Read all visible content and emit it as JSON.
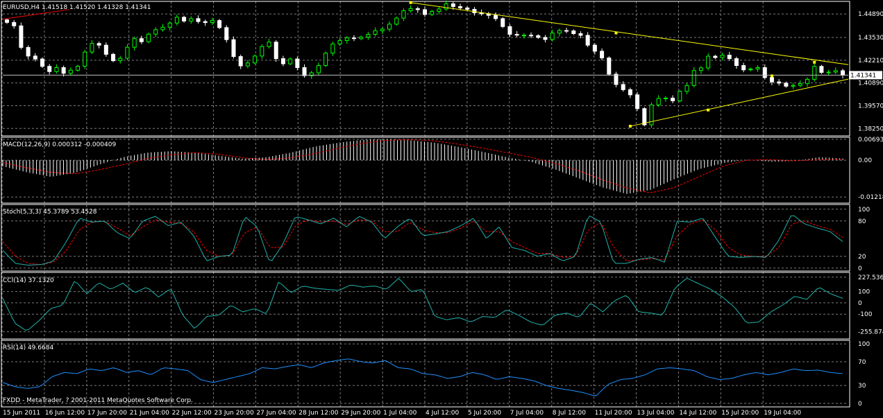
{
  "colors": {
    "background": "#000000",
    "grid": "#7c7c7c",
    "text": "#ffffff",
    "bull_candle": "#000000",
    "bull_border": "#00ff00",
    "bear_candle": "#ffffff",
    "trendline": "#ffff00",
    "red_line": "#ff0000",
    "macd_hist": "#ffffff",
    "signal": "#ff0000",
    "stoch_main": "#20b2aa",
    "cci": "#20b2aa",
    "rsi": "#1e90ff"
  },
  "header": {
    "price_title": "EURUSD,H4  1.41518 1.41520 1.41328 1.41341",
    "current_price": "1.41341",
    "copyright": "FXDD - MetaTrader, ? 2001-2011 MetaQuotes Software Corp."
  },
  "chart_data": [
    {
      "type": "candlestick",
      "title": "EURUSD,H4  1.41518 1.41520 1.41328 1.41341",
      "ylim": [
        1.3782,
        1.4562
      ],
      "y_ticks": [
        "1.44890",
        "1.43530",
        "1.42210",
        "1.40890",
        "1.39570",
        "1.38250"
      ],
      "current": 1.41341,
      "closes": [
        1.444,
        1.442,
        1.4295,
        1.4245,
        1.4228,
        1.4185,
        1.4155,
        1.4178,
        1.4145,
        1.4163,
        1.4186,
        1.4268,
        1.4318,
        1.4308,
        1.4255,
        1.4218,
        1.4232,
        1.4296,
        1.4346,
        1.4328,
        1.4372,
        1.4398,
        1.4412,
        1.4436,
        1.447,
        1.4448,
        1.4462,
        1.4445,
        1.4439,
        1.4451,
        1.441,
        1.434,
        1.4242,
        1.4188,
        1.4205,
        1.4245,
        1.43,
        1.4326,
        1.423,
        1.42,
        1.4228,
        1.4178,
        1.4131,
        1.4148,
        1.419,
        1.4262,
        1.4315,
        1.4335,
        1.435,
        1.4346,
        1.4355,
        1.4371,
        1.4392,
        1.4401,
        1.443,
        1.4465,
        1.4508,
        1.452,
        1.4514,
        1.4486,
        1.4504,
        1.4518,
        1.4548,
        1.4532,
        1.4524,
        1.4516,
        1.4496,
        1.449,
        1.4481,
        1.4462,
        1.4416,
        1.4371,
        1.4366,
        1.4366,
        1.4363,
        1.4353,
        1.4341,
        1.4378,
        1.4393,
        1.4391,
        1.4375,
        1.4365,
        1.4308,
        1.4273,
        1.4234,
        1.414,
        1.408,
        1.405,
        1.402,
        1.394,
        1.3846,
        1.3962,
        1.3999,
        1.4001,
        1.3985,
        1.404,
        1.4074,
        1.4161,
        1.4176,
        1.4244,
        1.4236,
        1.425,
        1.423,
        1.419,
        1.4165,
        1.417,
        1.4178,
        1.412,
        1.4095,
        1.4088,
        1.407,
        1.4075,
        1.4085,
        1.411,
        1.4185,
        1.415,
        1.4152,
        1.416,
        1.4134
      ],
      "trendlines": [
        {
          "from": [
            1.4555,
            1.4558
          ],
          "to": [
            1.4209,
            1.4195
          ],
          "via": 1.4379
        },
        {
          "from": [
            1.3838,
            1.3838
          ],
          "to": [
            1.413,
            1.4111
          ],
          "via": 1.3932
        }
      ]
    },
    {
      "type": "histogram_line",
      "title": "MACD(12,26,9) 0.000312 -0.000409",
      "ylim": [
        -0.0142,
        0.0076
      ],
      "y_ticks": [
        "0.00693",
        "0.00",
        "-0.01218"
      ],
      "histogram_keys": [
        -0.002,
        -0.004,
        -0.0055,
        -0.0042,
        -0.0015,
        0.001,
        0.0025,
        0.003,
        0.0025,
        0.0015,
        0.0005,
        0.001,
        0.0025,
        0.0045,
        0.0058,
        0.0068,
        0.007,
        0.0066,
        0.0058,
        0.0044,
        0.0028,
        0.001,
        -0.0005,
        -0.003,
        -0.006,
        -0.009,
        -0.0112,
        -0.0098,
        -0.0062,
        -0.003,
        -0.001,
        0.0002,
        -0.0005,
        -0.0003,
        0.001,
        0.0006
      ],
      "signal_keys": [
        -0.0008,
        -0.0025,
        -0.004,
        -0.0045,
        -0.0032,
        -0.0015,
        0.0005,
        0.0018,
        0.0025,
        0.002,
        0.0008,
        0.0002,
        0.0008,
        0.0022,
        0.004,
        0.0056,
        0.0066,
        0.0068,
        0.0064,
        0.0053,
        0.004,
        0.0025,
        0.001,
        -0.001,
        -0.0035,
        -0.0065,
        -0.0092,
        -0.0108,
        -0.009,
        -0.0055,
        -0.002,
        0.0,
        0.0002,
        -0.0002,
        0.0002,
        0.0003
      ]
    },
    {
      "type": "line",
      "title": "Stoch(5,3,3) 45.3789 53.4528",
      "ylim": [
        -5,
        108
      ],
      "y_ticks": [
        "100",
        "80",
        "20",
        "0"
      ],
      "main_keys": [
        30,
        8,
        5,
        6,
        12,
        45,
        85,
        78,
        80,
        60,
        50,
        80,
        88,
        72,
        78,
        55,
        12,
        20,
        22,
        88,
        70,
        8,
        40,
        88,
        82,
        75,
        85,
        70,
        88,
        78,
        50,
        70,
        85,
        55,
        58,
        62,
        72,
        85,
        50,
        70,
        35,
        30,
        20,
        25,
        12,
        20,
        90,
        78,
        8,
        8,
        15,
        18,
        10,
        80,
        78,
        85,
        52,
        20,
        18,
        20,
        18,
        48,
        92,
        75,
        68,
        62,
        45
      ],
      "signal_keys": [
        45,
        20,
        8,
        6,
        10,
        30,
        65,
        78,
        80,
        68,
        55,
        70,
        82,
        78,
        76,
        62,
        30,
        20,
        22,
        60,
        70,
        35,
        35,
        72,
        82,
        78,
        80,
        74,
        82,
        80,
        62,
        62,
        78,
        65,
        60,
        60,
        68,
        80,
        62,
        62,
        45,
        35,
        25,
        25,
        18,
        20,
        65,
        78,
        35,
        12,
        14,
        16,
        14,
        55,
        75,
        82,
        65,
        35,
        22,
        20,
        20,
        35,
        75,
        80,
        72,
        66,
        52
      ]
    },
    {
      "type": "line",
      "title": "CCI(14) 37.1320",
      "ylim": [
        -320,
        270
      ],
      "y_ticks": [
        "227.536",
        "100",
        "0",
        "-100",
        "-255.874"
      ],
      "values_keys": [
        40,
        -180,
        -250,
        -160,
        -50,
        -20,
        200,
        80,
        180,
        120,
        175,
        90,
        140,
        50,
        130,
        -110,
        -230,
        -120,
        -110,
        -20,
        -80,
        -50,
        -100,
        190,
        90,
        150,
        130,
        120,
        110,
        160,
        140,
        150,
        120,
        220,
        100,
        120,
        -120,
        -150,
        -130,
        -170,
        -120,
        -130,
        -60,
        -110,
        -170,
        -200,
        -110,
        -90,
        -130,
        0,
        -80,
        20,
        70,
        -80,
        -90,
        -110,
        130,
        220,
        170,
        120,
        50,
        -40,
        -180,
        -170,
        -80,
        -20,
        60,
        30,
        140,
        80,
        40
      ]
    },
    {
      "type": "line",
      "title": "RSI(14) 49.6684",
      "ylim": [
        -6,
        106
      ],
      "y_ticks": [
        "100",
        "70",
        "30",
        "0"
      ],
      "values_keys": [
        35,
        28,
        25,
        28,
        45,
        52,
        50,
        58,
        55,
        60,
        52,
        55,
        48,
        60,
        58,
        55,
        40,
        35,
        40,
        45,
        50,
        60,
        58,
        62,
        65,
        60,
        68,
        72,
        75,
        70,
        68,
        72,
        60,
        58,
        50,
        48,
        42,
        45,
        52,
        48,
        40,
        45,
        42,
        38,
        30,
        25,
        22,
        18,
        12,
        32,
        40,
        42,
        48,
        58,
        60,
        58,
        55,
        45,
        40,
        42,
        48,
        52,
        48,
        52,
        58,
        55,
        56,
        52,
        50
      ]
    }
  ],
  "panes": {
    "macd_title": "MACD(12,26,9) 0.000312 -0.000409",
    "stoch_title": "Stoch(5,3,3) 45.3789 53.4528",
    "cci_title": "CCI(14) 37.1320",
    "rsi_title": "RSI(14) 49.6684"
  },
  "time_axis": {
    "labels": [
      "15 Jun 2011",
      "16 Jun 12:00",
      "17 Jun 20:00",
      "21 Jun 04:00",
      "22 Jun 12:00",
      "23 Jun 20:00",
      "27 Jun 04:00",
      "28 Jun 12:00",
      "29 Jun 20:00",
      "1 Jul 04:00",
      "4 Jul 12:00",
      "5 Jul 20:00",
      "7 Jul 04:00",
      "8 Jul 12:00",
      "11 Jul 20:00",
      "13 Jul 04:00",
      "14 Jul 12:00",
      "15 Jul 20:00",
      "19 Jul 04:00"
    ]
  }
}
